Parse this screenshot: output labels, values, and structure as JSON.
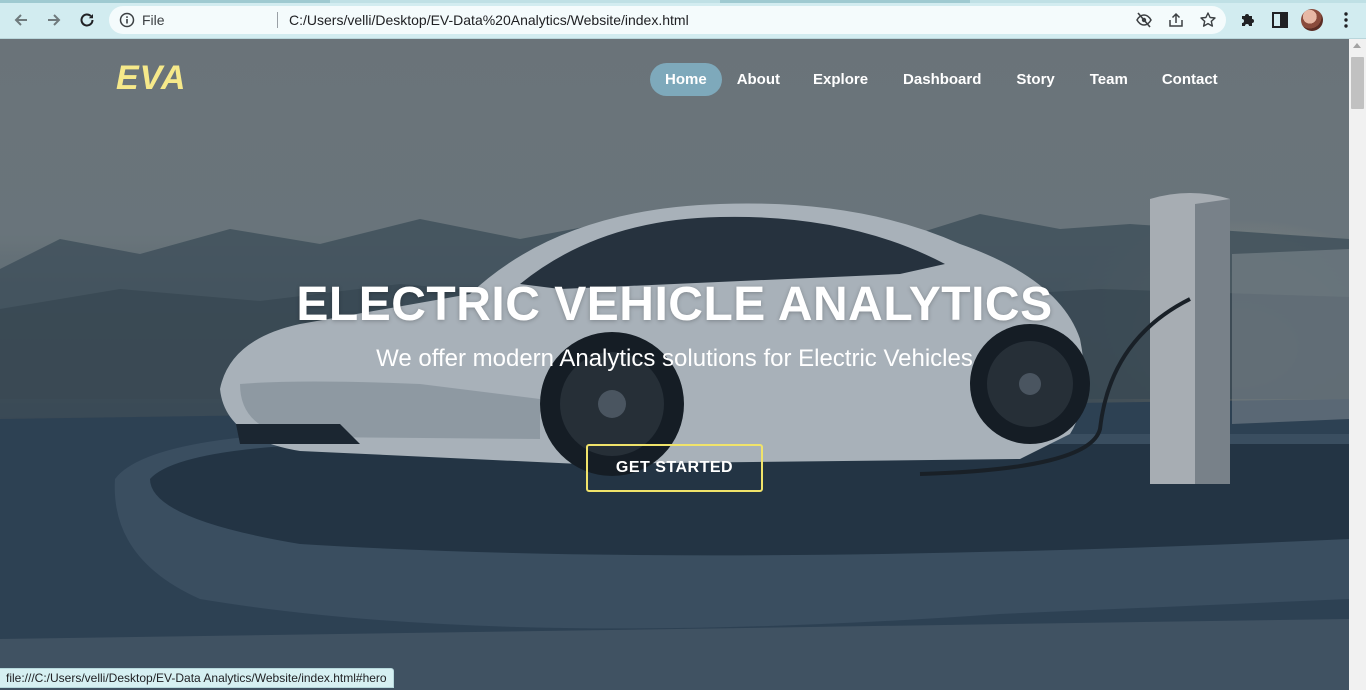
{
  "browser": {
    "omnibox": {
      "scheme_label": "File",
      "url": "C:/Users/velli/Desktop/EV-Data%20Analytics/Website/index.html"
    },
    "icons": {
      "back": "arrow-left-icon",
      "forward": "arrow-right-icon",
      "reload": "reload-icon",
      "info": "info-icon",
      "eye_off": "eye-off-icon",
      "share": "share-icon",
      "bookmark": "star-icon",
      "extensions": "puzzle-icon",
      "side_panel": "side-panel-icon",
      "menu": "kebab-menu-icon"
    },
    "status_url": "file:///C:/Users/velli/Desktop/EV-Data Analytics/Website/index.html#hero"
  },
  "site": {
    "logo": "EVA",
    "nav": [
      {
        "label": "Home",
        "active": true
      },
      {
        "label": "About",
        "active": false
      },
      {
        "label": "Explore",
        "active": false
      },
      {
        "label": "Dashboard",
        "active": false
      },
      {
        "label": "Story",
        "active": false
      },
      {
        "label": "Team",
        "active": false
      },
      {
        "label": "Contact",
        "active": false
      }
    ]
  },
  "hero": {
    "title": "ELECTRIC VEHICLE ANALYTICS",
    "subtitle": "We offer modern Analytics solutions for Electric Vehicles",
    "cta_label": "GET STARTED"
  },
  "colors": {
    "accent_logo": "#f6e98a",
    "cta_border": "#f0e36a",
    "nav_active_bg": "#7ea9bb",
    "chrome_bg": "#d2ecf0"
  }
}
